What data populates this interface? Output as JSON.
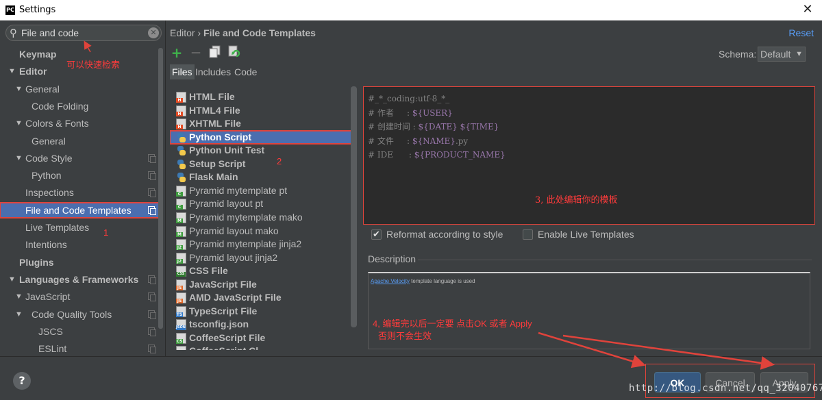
{
  "window": {
    "title": "Settings",
    "icon": "intellij-app-icon",
    "close_glyph": "✕"
  },
  "search": {
    "value": "File and code",
    "icon": "search-icon",
    "clear_glyph": "✕"
  },
  "tree": [
    {
      "label": "Keymap",
      "level": 0,
      "bold": true,
      "arrow": ""
    },
    {
      "label": "Editor",
      "level": 0,
      "bold": true,
      "arrow": "▼"
    },
    {
      "label": "General",
      "level": 1,
      "arrow": "▼"
    },
    {
      "label": "Code Folding",
      "level": 2,
      "arrow": ""
    },
    {
      "label": "Colors & Fonts",
      "level": 1,
      "arrow": "▼"
    },
    {
      "label": "General",
      "level": 2,
      "arrow": ""
    },
    {
      "label": "Code Style",
      "level": 1,
      "arrow": "▼",
      "copy": true
    },
    {
      "label": "Python",
      "level": 2,
      "arrow": "",
      "copy": true
    },
    {
      "label": "Inspections",
      "level": 1,
      "arrow": "",
      "copy": true
    },
    {
      "label": "File and Code Templates",
      "level": 1,
      "arrow": "",
      "copy": true,
      "selected": true
    },
    {
      "label": "Live Templates",
      "level": 1,
      "arrow": ""
    },
    {
      "label": "Intentions",
      "level": 1,
      "arrow": ""
    },
    {
      "label": "Plugins",
      "level": 0,
      "bold": true,
      "arrow": ""
    },
    {
      "label": "Languages & Frameworks",
      "level": 0,
      "bold": true,
      "arrow": "▼",
      "copy": true
    },
    {
      "label": "JavaScript",
      "level": 1,
      "arrow": "▼",
      "copy": true
    },
    {
      "label": "Code Quality Tools",
      "level": 2,
      "arrow": "▼",
      "copy": true
    },
    {
      "label": "JSCS",
      "level": 3,
      "arrow": "",
      "copy": true
    },
    {
      "label": "ESLint",
      "level": 3,
      "arrow": "",
      "copy": true
    }
  ],
  "breadcrumb": {
    "parent": "Editor",
    "separator": "›",
    "current": "File and Code Templates"
  },
  "reset_label": "Reset",
  "toolbar": {
    "add_glyph": "+",
    "add_color": "#3fb24b",
    "remove_glyph": "—",
    "copy_icon": "copy-icon",
    "reset_icon": "reset-to-default-icon"
  },
  "schema": {
    "label": "Schema:",
    "value": "Default",
    "dropdown_glyph": "▼"
  },
  "tabs": [
    "Files",
    "Includes",
    "Code"
  ],
  "files": [
    {
      "name": "HTML File",
      "icon": "html",
      "tag": "H",
      "color": "#e44d26",
      "bold": true
    },
    {
      "name": "HTML4 File",
      "icon": "html",
      "tag": "H",
      "color": "#e44d26",
      "bold": true
    },
    {
      "name": "XHTML File",
      "icon": "html",
      "tag": "H",
      "color": "#e44d26",
      "bold": true
    },
    {
      "name": "Python Script",
      "icon": "python",
      "bold": true,
      "selected": true
    },
    {
      "name": "Python Unit Test",
      "icon": "python",
      "bold": true
    },
    {
      "name": "Setup Script",
      "icon": "python",
      "bold": true
    },
    {
      "name": "Flask Main",
      "icon": "python",
      "bold": true
    },
    {
      "name": "Pyramid mytemplate pt",
      "icon": "template",
      "tag": "C",
      "color": "#3f9b3f"
    },
    {
      "name": "Pyramid layout pt",
      "icon": "template",
      "tag": "C",
      "color": "#3f9b3f"
    },
    {
      "name": "Pyramid mytemplate mako",
      "icon": "template",
      "tag": "M",
      "color": "#3f9b3f"
    },
    {
      "name": "Pyramid layout mako",
      "icon": "template",
      "tag": "M",
      "color": "#3f9b3f"
    },
    {
      "name": "Pyramid mytemplate jinja2",
      "icon": "template",
      "tag": "J2",
      "color": "#3f9b3f"
    },
    {
      "name": "Pyramid layout jinja2",
      "icon": "template",
      "tag": "J2",
      "color": "#3f9b3f"
    },
    {
      "name": "CSS File",
      "icon": "css",
      "tag": "CSS",
      "color": "#2e7a2e",
      "bold": true
    },
    {
      "name": "JavaScript File",
      "icon": "js",
      "tag": "JS",
      "color": "#e06b2c",
      "bold": true
    },
    {
      "name": "AMD JavaScript File",
      "icon": "js",
      "tag": "JS",
      "color": "#e06b2c",
      "bold": true
    },
    {
      "name": "TypeScript File",
      "icon": "ts",
      "tag": "TS",
      "color": "#3178c6",
      "bold": true
    },
    {
      "name": "tsconfig.json",
      "icon": "json",
      "tag": "JSON",
      "color": "#3178c6",
      "bold": true
    },
    {
      "name": "CoffeeScript File",
      "icon": "coffee",
      "tag": "CS",
      "color": "#3f9b3f",
      "bold": true
    },
    {
      "name": "CoffeeScript Cl...",
      "icon": "coffee",
      "tag": "CS",
      "color": "#3f9b3f",
      "bold": true
    }
  ],
  "editor": {
    "lines": [
      [
        {
          "t": "#_*_coding:utf-8_*_",
          "c": "cmt"
        }
      ],
      [
        {
          "t": "# 作者     : ",
          "c": "cmt"
        },
        {
          "t": "${USER}",
          "c": "var"
        }
      ],
      [
        {
          "t": "# 创建时间 : ",
          "c": "cmt"
        },
        {
          "t": "${DATE} ${TIME}",
          "c": "var"
        }
      ],
      [
        {
          "t": "# 文件     : ",
          "c": "cmt"
        },
        {
          "t": "${NAME}",
          "c": "var"
        },
        {
          "t": ".py",
          "c": "cmt"
        }
      ],
      [
        {
          "t": "# IDE      : ",
          "c": "cmt"
        },
        {
          "t": "${PRODUCT_NAME}",
          "c": "var"
        }
      ]
    ]
  },
  "options": {
    "reformat": {
      "label": "Reformat according to style",
      "checked": true
    },
    "live_templates": {
      "label": "Enable Live Templates",
      "checked": false
    }
  },
  "description": {
    "label": "Description",
    "link": "Apache Velocity",
    "text": " template language is used"
  },
  "buttons": {
    "ok": "OK",
    "cancel": "Cancel",
    "apply": "Apply",
    "help": "?"
  },
  "annotations": {
    "search_tip": "可以快速检索",
    "num1": "1",
    "num2": "2",
    "editor_tip": "3, 此处编辑你的模板",
    "apply_tip_1": "4, 编辑完以后一定要 点击OK 或者 Apply",
    "apply_tip_2": "否则不会生效"
  },
  "watermark": "http://blog.csdn.net/qq_32040767",
  "colors": {
    "annotation_red": "#e0433b",
    "selection": "#4b6eaf",
    "link": "#589df6",
    "template_var": "#9876aa"
  }
}
